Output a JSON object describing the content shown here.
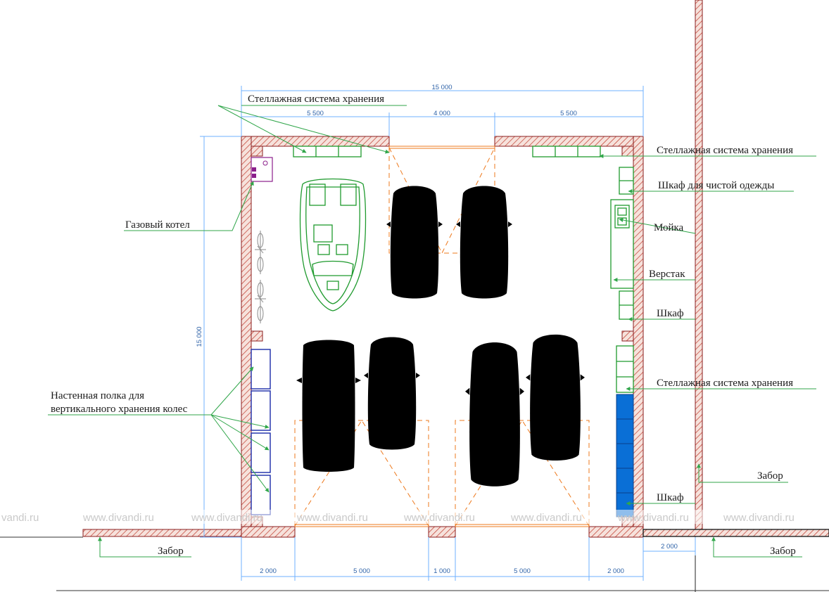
{
  "labels": {
    "shelving_top_left": "Стеллажная система хранения",
    "shelving_top_right": "Стеллажная система хранения",
    "clean_clothes_cabinet": "Шкаф для чистой одежды",
    "sink": "Мойка",
    "workbench": "Верстак",
    "cabinet_upper": "Шкаф",
    "shelving_right": "Стеллажная система хранения",
    "cabinet_lower": "Шкаф",
    "gas_boiler": "Газовый котел",
    "wheel_shelf_line1": "Настенная полка для",
    "wheel_shelf_line2": "вертикального хранения колес",
    "fence_left": "Забор",
    "fence_right_upper": "Забор",
    "fence_right_lower": "Забор"
  },
  "dimensions": {
    "overall_top": "15 000",
    "top_left": "5 500",
    "top_middle": "4 000",
    "top_right": "5 500",
    "overall_left": "15 000",
    "bottom_1": "2 000",
    "bottom_2": "5 000",
    "bottom_3": "1 000",
    "bottom_4": "5 000",
    "bottom_5": "2 000",
    "outside_right": "2 000"
  },
  "watermark": {
    "text": "www.divandi.ru",
    "partial_text": "vandi.ru"
  },
  "colors": {
    "wall_hatch": "#c0392b",
    "furniture_line": "#1f9a2e",
    "door_swing": "#ee7a1e",
    "dimension_line": "#6fb1ff",
    "wheel_shelf": "#1a2aa8",
    "cabinet_fill": "#0a6fd6",
    "boiler": "#8b1f8b"
  }
}
